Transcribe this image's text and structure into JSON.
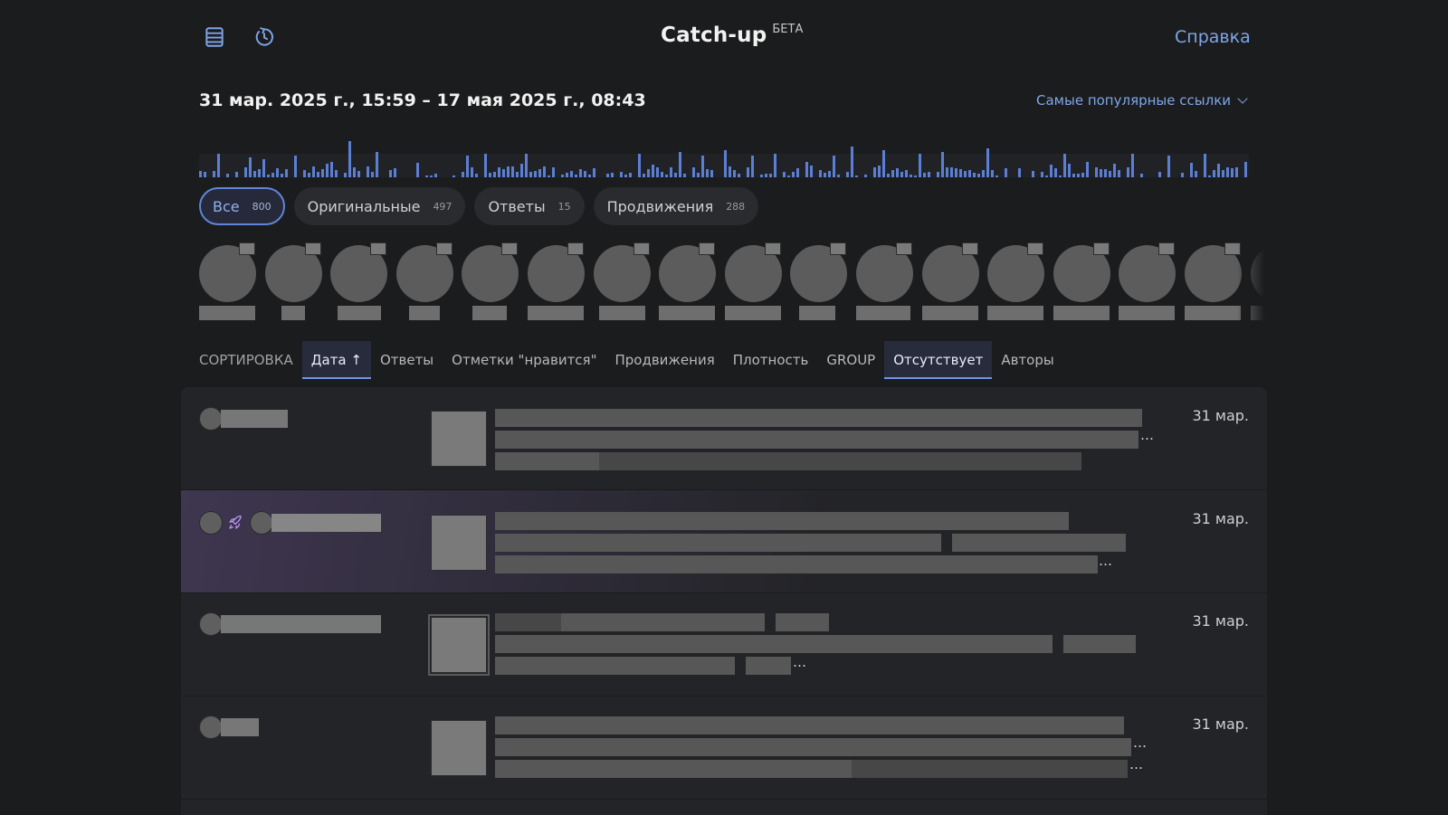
{
  "header": {
    "title": "Catch-up",
    "beta": "БЕТА",
    "help": "Справка",
    "icons": [
      "list-view-icon",
      "refresh-icon"
    ]
  },
  "range": {
    "text": "31 мар. 2025 г., 15:59 – 17 мая 2025 г., 08:43",
    "top_links": "Самые популярные ссылки"
  },
  "filters": [
    {
      "label": "Все",
      "count": "800"
    },
    {
      "label": "Оригинальные",
      "count": "497"
    },
    {
      "label": "Ответы",
      "count": "15"
    },
    {
      "label": "Продвижения",
      "count": "288"
    }
  ],
  "sort": {
    "label": "СОРТИРОВКА",
    "tabs": [
      "Дата ↑",
      "Ответы",
      "Отметки \"нравится\"",
      "Продвижения",
      "Плотность"
    ],
    "group_label": "GROUP",
    "group_tabs": [
      "Отсутствует",
      "Авторы"
    ]
  },
  "feed": {
    "dates": [
      "31 мар.",
      "31 мар.",
      "31 мар.",
      "31 мар."
    ],
    "ellipsis": "…"
  },
  "colors": {
    "accent": "#7fa6e8",
    "histogram_bar": "#5b7fd3",
    "promo_icon": "#b892ee",
    "background": "#1b1c1e"
  }
}
